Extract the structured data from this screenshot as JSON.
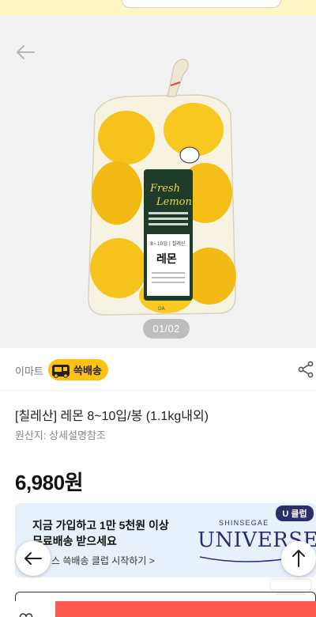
{
  "hero": {
    "pager": "01/02",
    "package": {
      "brand_line1": "Fresh",
      "brand_line2": "Lemon",
      "spec": "8~10입 | 칠레산",
      "name": "레몬"
    }
  },
  "seller": {
    "name": "이마트",
    "delivery_badge": "쓱배송"
  },
  "product": {
    "title": "[칠레산] 레몬 8~10입/봉 (1.1kg내외)",
    "origin": "원산지: 상세설명참조",
    "price": "6,980원"
  },
  "banner": {
    "line1": "지금 가입하고 1만 5천원 이상",
    "line2": "무료배송 받으세요",
    "cta": "스 쓱배송 클럽 시작하기 >",
    "brand_sub": "SHINSEGAE",
    "brand": "UNIVERSE",
    "badge": "U 클럽"
  },
  "colors": {
    "accent_yellow": "#ffc20e",
    "brand_navy": "#2a2f6b",
    "buy_red": "#ff5a4f",
    "banner_bg": "#e8f0fb"
  },
  "icons": [
    "back-arrow-icon",
    "share-icon",
    "truck-icon",
    "left-arrow-icon",
    "up-arrow-icon",
    "heart-icon"
  ]
}
